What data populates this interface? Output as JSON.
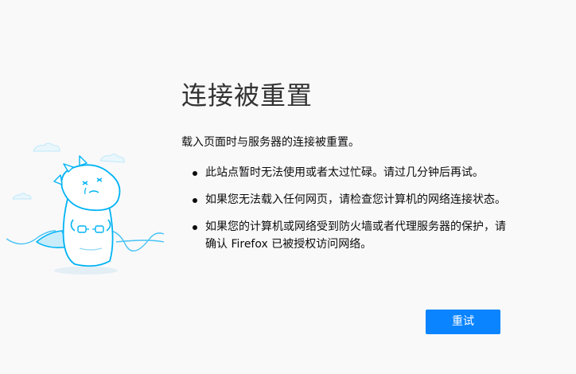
{
  "error": {
    "title": "连接被重置",
    "description": "载入页面时与服务器的连接被重置。",
    "tips": [
      "此站点暂时无法使用或者太过忙碌。请过几分钟后再试。",
      "如果您无法载入任何网页，请检查您计算机的网络连接状态。",
      "如果您的计算机或网络受到防火墙或者代理服务器的保护，请确认 Firefox 已被授权访问网络。"
    ],
    "retry_label": "重试"
  },
  "colors": {
    "background": "#f9f9fa",
    "accent": "#0a84ff",
    "illustration_stroke": "#00b3f4",
    "illustration_fill": "#e6f7fe"
  },
  "icons": {
    "illustration": "network-dinosaur-unplugged-illustration"
  }
}
